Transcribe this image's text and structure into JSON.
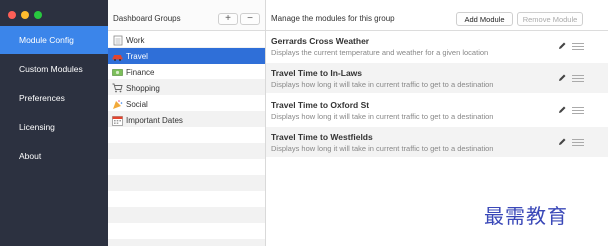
{
  "window": {
    "controls": [
      "close",
      "minimize",
      "zoom"
    ],
    "colors": {
      "close": "#fd5f57",
      "minimize": "#febb2e",
      "zoom": "#28c83f"
    }
  },
  "sidebar": {
    "active_color": "#3b85ea",
    "items": [
      {
        "label": "Module Config",
        "active": true
      },
      {
        "label": "Custom Modules",
        "active": false
      },
      {
        "label": "Preferences",
        "active": false
      },
      {
        "label": "Licensing",
        "active": false
      },
      {
        "label": "About",
        "active": false
      }
    ]
  },
  "groups": {
    "header": "Dashboard Groups",
    "add_label": "+",
    "remove_label": "−",
    "items": [
      {
        "label": "Work",
        "icon": "notepad-icon",
        "selected": false
      },
      {
        "label": "Travel",
        "icon": "car-icon",
        "selected": true
      },
      {
        "label": "Finance",
        "icon": "money-icon",
        "selected": false
      },
      {
        "label": "Shopping",
        "icon": "cart-icon",
        "selected": false
      },
      {
        "label": "Social",
        "icon": "party-icon",
        "selected": false
      },
      {
        "label": "Important Dates",
        "icon": "calendar-icon",
        "selected": false
      }
    ]
  },
  "main": {
    "header": "Manage the modules for this group",
    "add_button": "Add Module",
    "remove_button": "Remove Module",
    "modules": [
      {
        "title": "Gerrards Cross Weather",
        "description": "Displays the current temperature and weather for a given location"
      },
      {
        "title": "Travel Time to In-Laws",
        "description": "Displays how long it will take in current traffic to get to a destination"
      },
      {
        "title": "Travel Time to Oxford St",
        "description": "Displays how long it will take in current traffic to get to a destination"
      },
      {
        "title": "Travel Time to Westfields",
        "description": "Displays how long it will take in current traffic to get to a destination"
      }
    ]
  },
  "watermark": "最需教育"
}
